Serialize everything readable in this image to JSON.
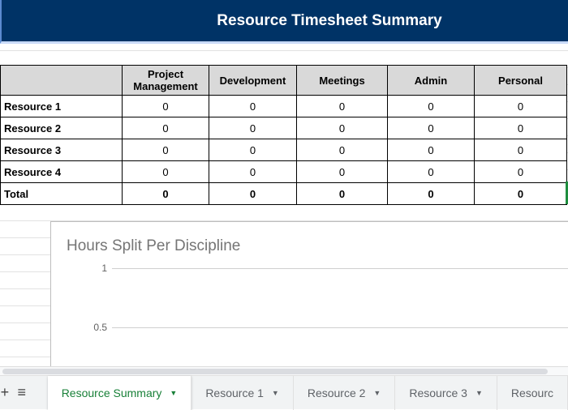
{
  "header": {
    "title": "Resource Timesheet Summary"
  },
  "table": {
    "columns": [
      "Project Management",
      "Development",
      "Meetings",
      "Admin",
      "Personal"
    ],
    "rows": [
      {
        "label": "Resource 1",
        "values": [
          "0",
          "0",
          "0",
          "0",
          "0"
        ]
      },
      {
        "label": "Resource 2",
        "values": [
          "0",
          "0",
          "0",
          "0",
          "0"
        ]
      },
      {
        "label": "Resource 3",
        "values": [
          "0",
          "0",
          "0",
          "0",
          "0"
        ]
      },
      {
        "label": "Resource 4",
        "values": [
          "0",
          "0",
          "0",
          "0",
          "0"
        ]
      },
      {
        "label": "Total",
        "values": [
          "0",
          "0",
          "0",
          "0",
          "0"
        ]
      }
    ]
  },
  "chart_data": {
    "type": "bar",
    "title": "Hours Split Per Discipline",
    "yticks": [
      "1",
      "0.5"
    ],
    "ylim": [
      0,
      1
    ],
    "categories": [],
    "values": []
  },
  "tabs": {
    "add_icon": "+",
    "menu_icon": "≡",
    "items": [
      {
        "label": "Resource Summary"
      },
      {
        "label": "Resource 1"
      },
      {
        "label": "Resource 2"
      },
      {
        "label": "Resource 3"
      },
      {
        "label": "Resourc"
      }
    ]
  },
  "colors": {
    "header": "#003366",
    "active_tab": "#188038"
  }
}
